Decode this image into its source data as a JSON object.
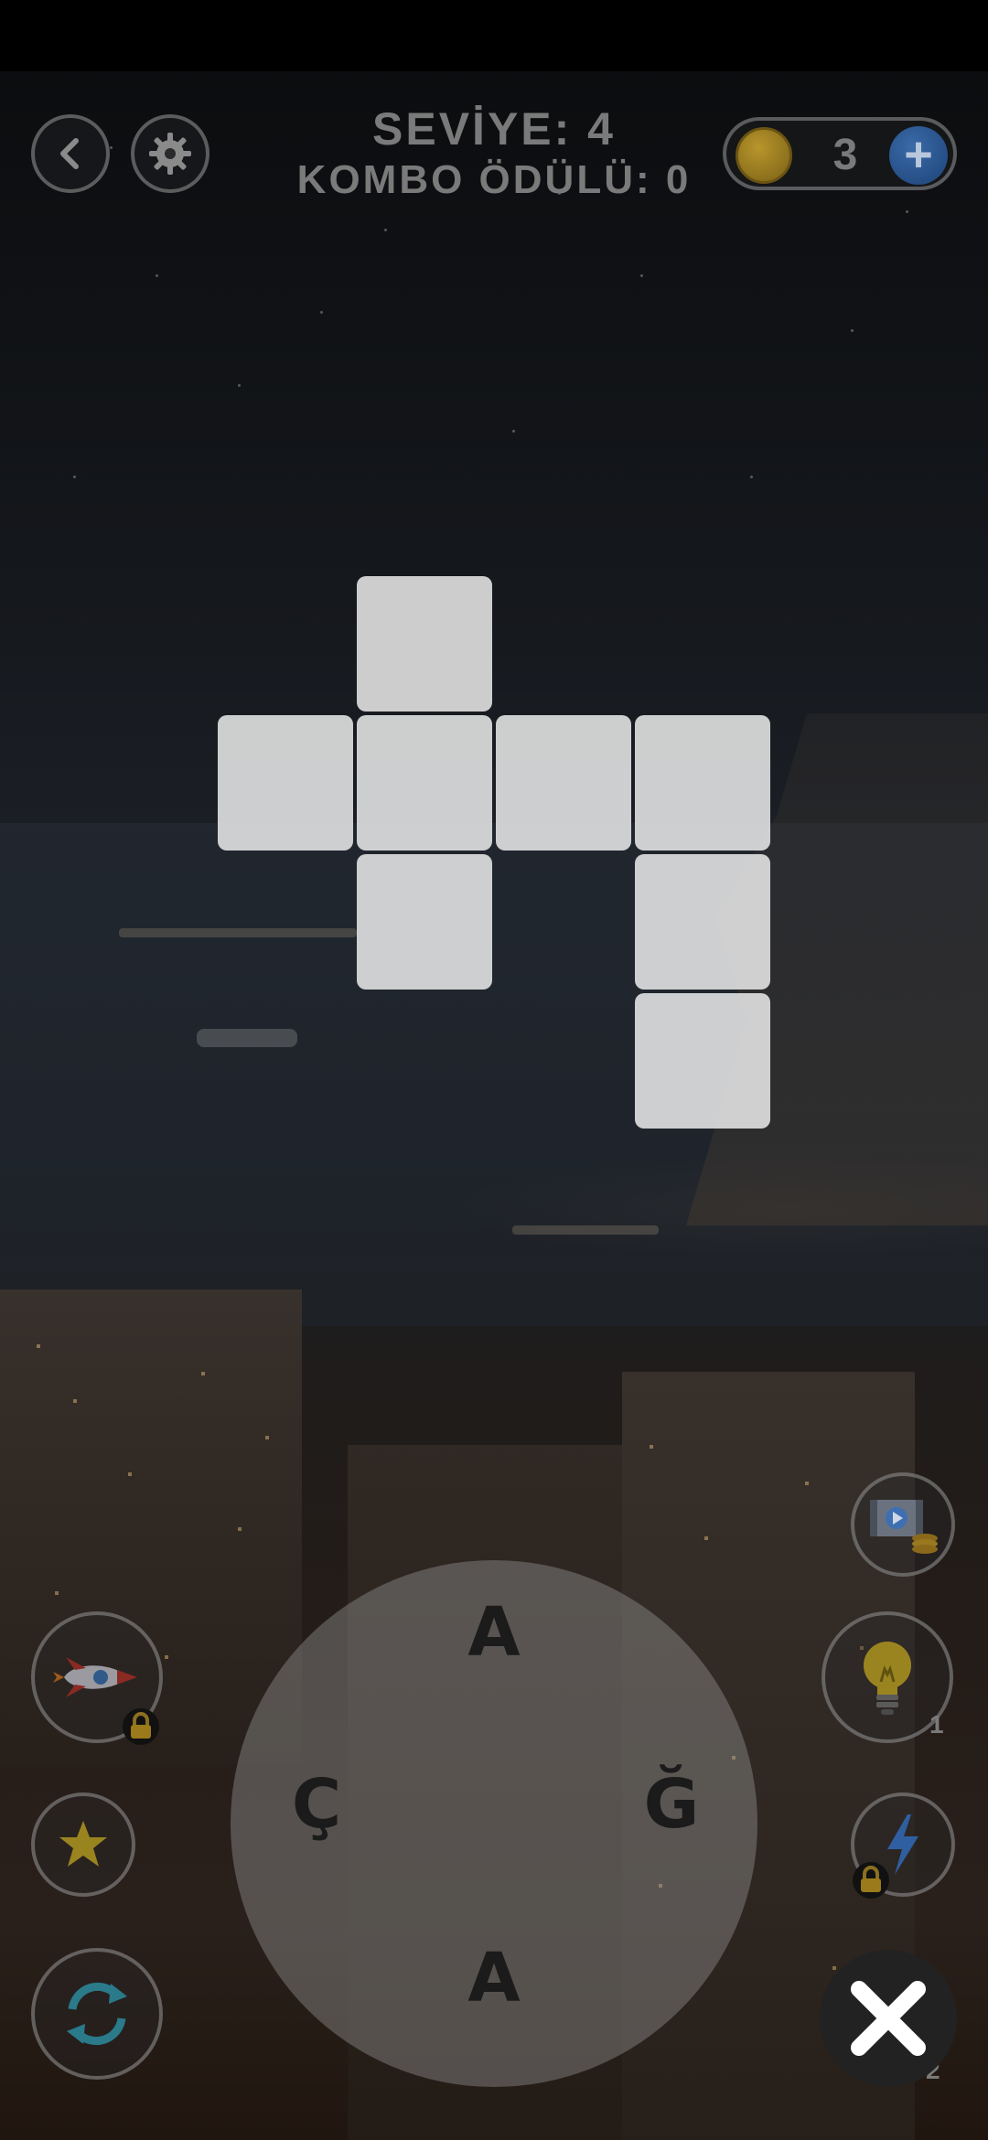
{
  "header": {
    "level_text": "SEVİYE: 4",
    "combo_text": "KOMBO ÖDÜLÜ: 0"
  },
  "coins": {
    "count": "3"
  },
  "wheel": {
    "letters": [
      "A",
      "Ç",
      "Ğ",
      "A"
    ]
  },
  "powerups": {
    "hint_count": "1",
    "close_counter": "2"
  },
  "icons": {
    "back": "back-arrow-icon",
    "settings": "gear-icon",
    "coin": "coin-icon",
    "plus": "plus-icon",
    "video": "video-coins-icon",
    "rocket": "rocket-icon",
    "hint": "lightbulb-icon",
    "star": "star-icon",
    "bolt": "lightning-icon",
    "shuffle": "shuffle-icon",
    "close": "close-icon",
    "lock": "lock-icon"
  },
  "colors": {
    "cell": "#EBEBEB",
    "coin": "#B8962C",
    "plus": "#3A6AA8",
    "hud_text": "#7A7A7A"
  }
}
